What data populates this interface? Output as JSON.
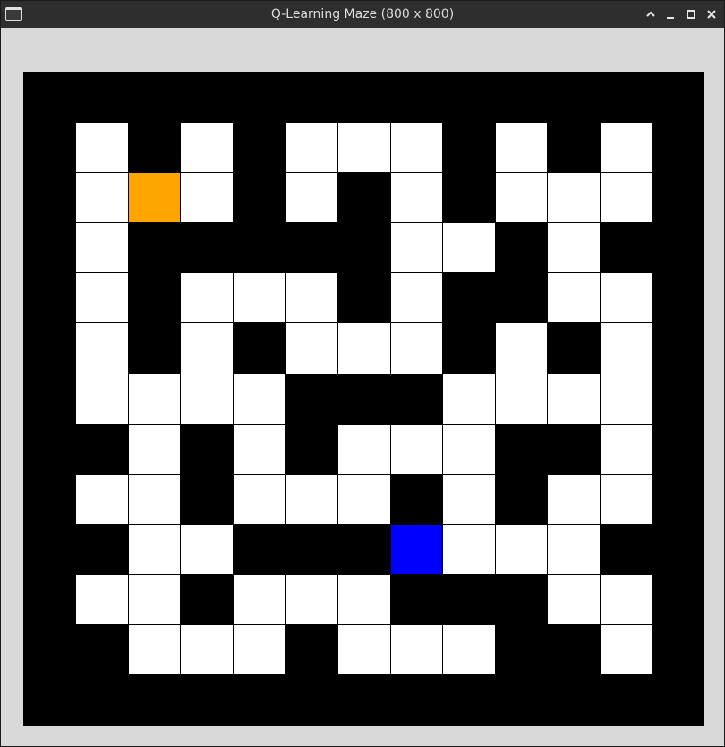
{
  "window": {
    "title": "Q-Learning Maze (800 x 800)",
    "icons": [
      "app-window-icon",
      "chevron-up-icon",
      "minimize-icon",
      "maximize-icon",
      "close-icon"
    ]
  },
  "maze": {
    "rows": 11,
    "cols": 11,
    "legend": {
      "0": "wall",
      "1": "open",
      "2": "agent",
      "3": "goal"
    },
    "colors": {
      "wall": "#000000",
      "open": "#ffffff",
      "agent": "#ffa500",
      "goal": "#0000ff"
    },
    "grid": [
      [
        1,
        0,
        1,
        0,
        1,
        1,
        1,
        0,
        1,
        0,
        1
      ],
      [
        1,
        2,
        1,
        0,
        1,
        0,
        1,
        0,
        1,
        1,
        1
      ],
      [
        1,
        0,
        0,
        0,
        0,
        0,
        1,
        1,
        0,
        1,
        0
      ],
      [
        1,
        0,
        1,
        1,
        1,
        0,
        1,
        0,
        0,
        1,
        1
      ],
      [
        1,
        0,
        1,
        0,
        1,
        1,
        1,
        0,
        1,
        0,
        1
      ],
      [
        1,
        1,
        1,
        1,
        0,
        0,
        0,
        1,
        1,
        1,
        1
      ],
      [
        0,
        1,
        0,
        1,
        0,
        1,
        1,
        1,
        0,
        0,
        1
      ],
      [
        1,
        1,
        0,
        1,
        1,
        1,
        0,
        1,
        0,
        1,
        1
      ],
      [
        0,
        1,
        1,
        0,
        0,
        0,
        3,
        1,
        1,
        1,
        0
      ],
      [
        1,
        1,
        0,
        1,
        1,
        1,
        0,
        0,
        0,
        1,
        1
      ],
      [
        0,
        1,
        1,
        1,
        0,
        1,
        1,
        1,
        0,
        0,
        1
      ]
    ]
  }
}
